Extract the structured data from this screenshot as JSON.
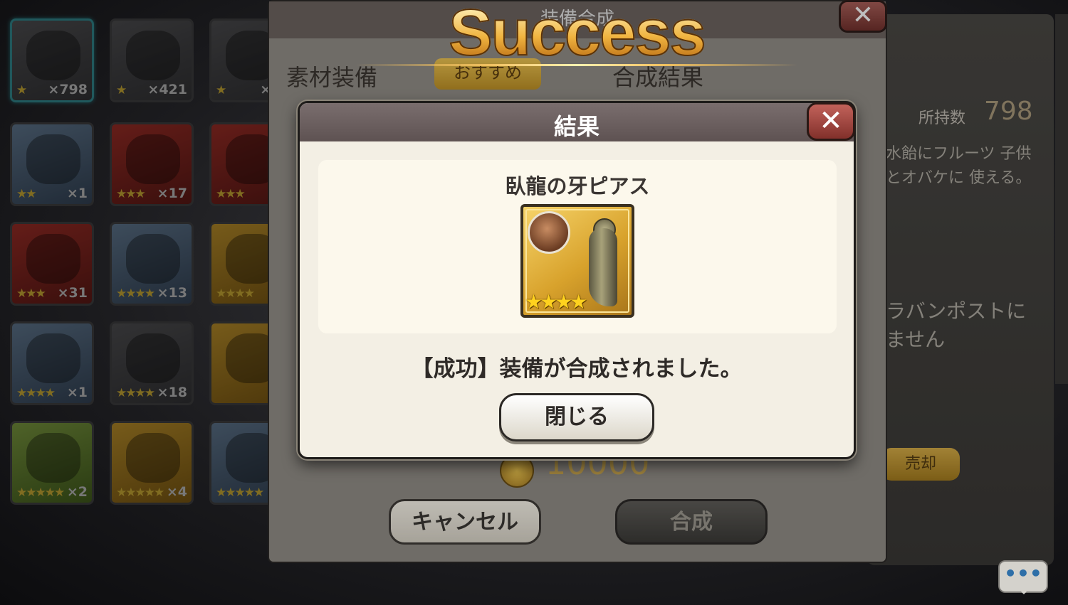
{
  "inventory": [
    {
      "stars": "★",
      "count": "×798"
    },
    {
      "stars": "★",
      "count": "×421"
    },
    {
      "stars": "★",
      "count": "×1("
    },
    {
      "stars": "★★",
      "count": "×1"
    },
    {
      "stars": "★★★",
      "count": "×17"
    },
    {
      "stars": "★★★",
      "count": ""
    },
    {
      "stars": "★★★",
      "count": "×31"
    },
    {
      "stars": "★★★★",
      "count": "×13"
    },
    {
      "stars": "★★★★",
      "count": ""
    },
    {
      "stars": "★★★★",
      "count": "×1"
    },
    {
      "stars": "★★★★",
      "count": "×18"
    },
    {
      "stars": "",
      "count": ""
    },
    {
      "stars": "★★★★★",
      "count": "×2"
    },
    {
      "stars": "★★★★★",
      "count": "×4"
    },
    {
      "stars": "★★★★★",
      "count": ""
    }
  ],
  "synth_window": {
    "title": "装備合成",
    "tab_material": "素材装備",
    "tab_recommend": "おすすめ",
    "tab_result": "合成結果",
    "cost": "10000",
    "cancel_label": "キャンセル",
    "combine_label": "合成",
    "close_glyph": "✕"
  },
  "info_panel": {
    "owned_label": "所持数",
    "owned_value": "798",
    "desc_lines": "水飴にフルーツ 子供とオバケに 使える。",
    "desc2": "ラバンポストに ません",
    "sell_label": "売却"
  },
  "banner": {
    "text": "Success"
  },
  "dialog": {
    "title": "結果",
    "close_glyph": "✕",
    "item_name": "臥龍の牙ピアス",
    "item_stars": "★★★★",
    "message": "【成功】装備が合成されました。",
    "ok_label": "閉じる"
  },
  "chat": {
    "glyph": "•••"
  },
  "colors": {
    "accent_gold": "#f0b440",
    "close_red": "#82302b",
    "dialog_bg": "#f3efe4"
  }
}
